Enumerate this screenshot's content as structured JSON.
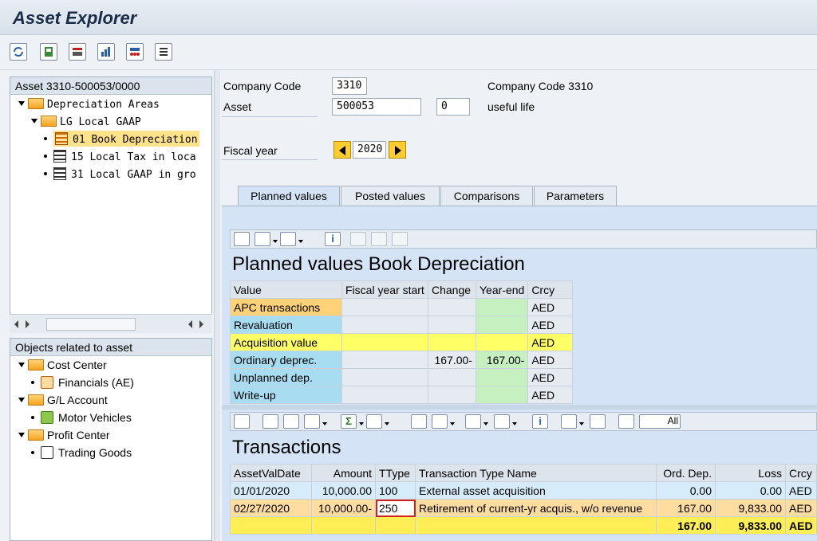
{
  "app": {
    "title": "Asset Explorer"
  },
  "toolbar_icons": [
    "refresh-icon",
    "save-icon",
    "values-icon",
    "chart-icon",
    "tree-icon",
    "list-icon"
  ],
  "left": {
    "header": "Asset 3310-500053/0000",
    "tree": [
      {
        "label": "Depreciation Areas",
        "type": "folder",
        "level": 0
      },
      {
        "label": "LG Local GAAP",
        "type": "folder",
        "level": 1
      },
      {
        "label": "01 Book Depreciation",
        "type": "area",
        "level": 2,
        "selected": true
      },
      {
        "label": "15 Local Tax in loca",
        "type": "area",
        "level": 2
      },
      {
        "label": "31 Local GAAP in gro",
        "type": "area",
        "level": 2
      }
    ],
    "related_header": "Objects related to asset",
    "related": [
      {
        "label": "Cost Center",
        "type": "folder"
      },
      {
        "label": "Financials (AE)",
        "type": "item"
      },
      {
        "label": "G/L Account",
        "type": "folder"
      },
      {
        "label": "Motor Vehicles",
        "type": "item"
      },
      {
        "label": "Profit Center",
        "type": "folder"
      },
      {
        "label": "Trading Goods",
        "type": "item"
      }
    ]
  },
  "header": {
    "company_code_label": "Company Code",
    "company_code_value": "3310",
    "company_code_desc": "Company Code 3310",
    "asset_label": "Asset",
    "asset_value": "500053",
    "sub_value": "0",
    "asset_desc": "useful life",
    "fiscal_year_label": "Fiscal year",
    "fiscal_year_value": "2020"
  },
  "tabs": [
    "Planned values",
    "Posted values",
    "Comparisons",
    "Parameters"
  ],
  "planned": {
    "title": "Planned values Book Depreciation",
    "columns": [
      "Value",
      "Fiscal year start",
      "Change",
      "Year-end",
      "Crcy"
    ],
    "rows": [
      {
        "value": "APC transactions",
        "start": "",
        "change": "",
        "year_end": "",
        "crcy": "AED"
      },
      {
        "value": "Revaluation",
        "start": "",
        "change": "",
        "year_end": "",
        "crcy": "AED"
      },
      {
        "value": "Acquisition value",
        "start": "",
        "change": "",
        "year_end": "",
        "crcy": "AED"
      },
      {
        "value": "Ordinary deprec.",
        "start": "",
        "change": "167.00-",
        "year_end": "167.00-",
        "crcy": "AED"
      },
      {
        "value": "Unplanned dep.",
        "start": "",
        "change": "",
        "year_end": "",
        "crcy": "AED"
      },
      {
        "value": "Write-up",
        "start": "",
        "change": "",
        "year_end": "",
        "crcy": "AED"
      }
    ]
  },
  "transactions": {
    "title": "Transactions",
    "all_label": "All",
    "columns": [
      "AssetValDate",
      "Amount",
      "TType",
      "Transaction Type Name",
      "Ord. Dep.",
      "Loss",
      "Crcy"
    ],
    "rows": [
      {
        "date": "01/01/2020",
        "amount": "10,000.00",
        "ttype": "100",
        "name": "External asset acquisition",
        "ord_dep": "0.00",
        "loss": "0.00",
        "crcy": "AED"
      },
      {
        "date": "02/27/2020",
        "amount": "10,000.00-",
        "ttype": "250",
        "name": "Retirement of current-yr acquis., w/o revenue",
        "ord_dep": "167.00",
        "loss": "9,833.00",
        "crcy": "AED"
      }
    ],
    "total": {
      "ord_dep": "167.00",
      "loss": "9,833.00",
      "crcy": "AED"
    }
  }
}
